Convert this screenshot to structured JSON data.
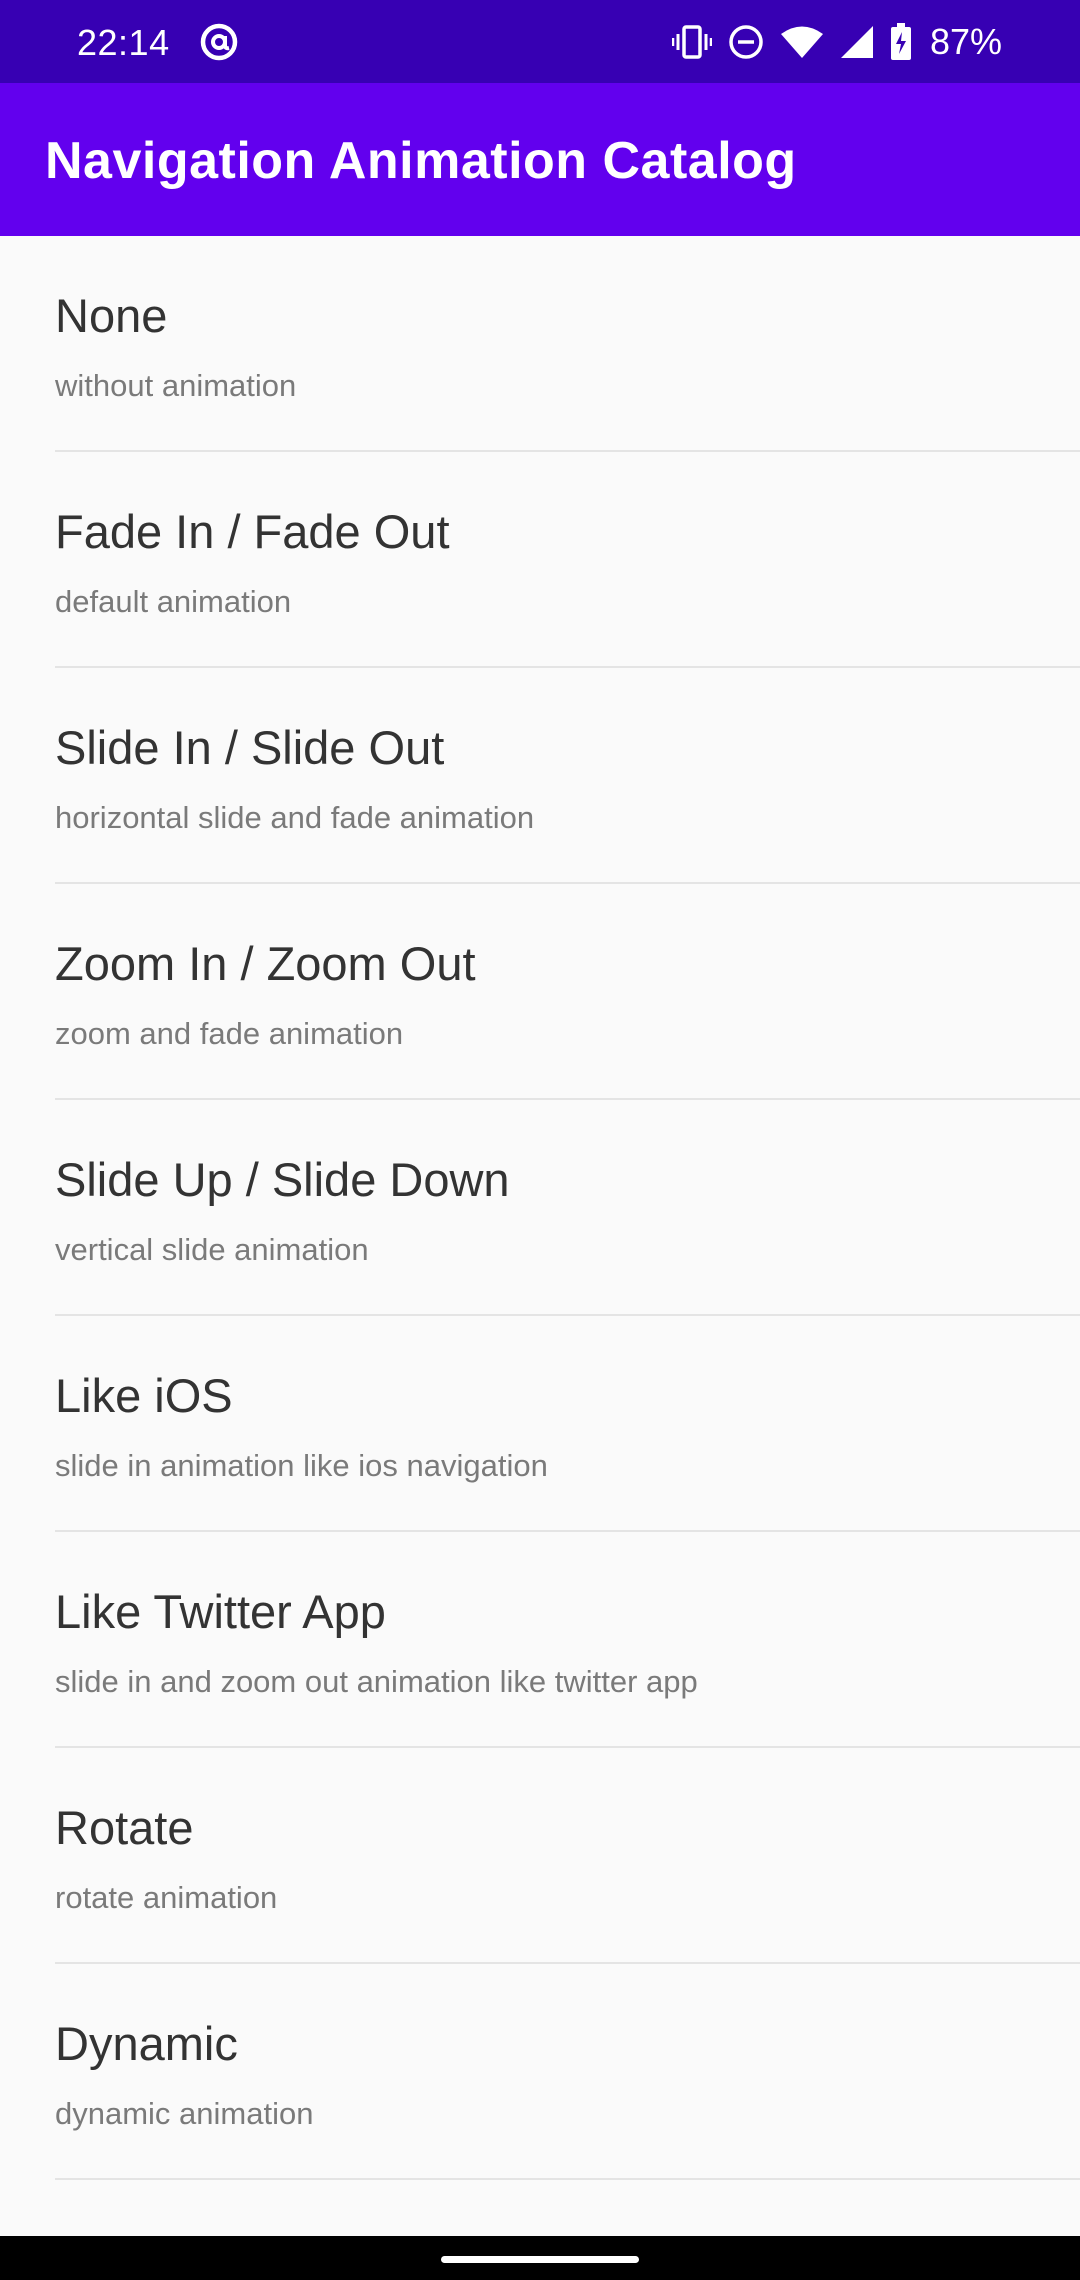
{
  "status_bar": {
    "time": "22:14",
    "battery_percent": "87%",
    "icons": [
      "at-sign-icon",
      "vibrate-icon",
      "do-not-disturb-icon",
      "wifi-icon",
      "signal-icon",
      "battery-charging-icon"
    ]
  },
  "app_bar": {
    "title": "Navigation Animation Catalog",
    "color": "#6200EE"
  },
  "list": {
    "items": [
      {
        "title": "None",
        "subtitle": "without animation"
      },
      {
        "title": "Fade In / Fade Out",
        "subtitle": "default animation"
      },
      {
        "title": "Slide In / Slide Out",
        "subtitle": "horizontal slide and fade animation"
      },
      {
        "title": "Zoom In / Zoom Out",
        "subtitle": "zoom and fade animation"
      },
      {
        "title": "Slide Up / Slide Down",
        "subtitle": "vertical slide animation"
      },
      {
        "title": "Like iOS",
        "subtitle": "slide in animation like ios navigation"
      },
      {
        "title": "Like Twitter App",
        "subtitle": "slide in and zoom out animation like twitter app"
      },
      {
        "title": "Rotate",
        "subtitle": "rotate animation"
      },
      {
        "title": "Dynamic",
        "subtitle": "dynamic animation"
      }
    ]
  },
  "colors": {
    "status_bar": "#3700B3",
    "app_bar": "#6200EE",
    "background": "#FAFAFA"
  }
}
